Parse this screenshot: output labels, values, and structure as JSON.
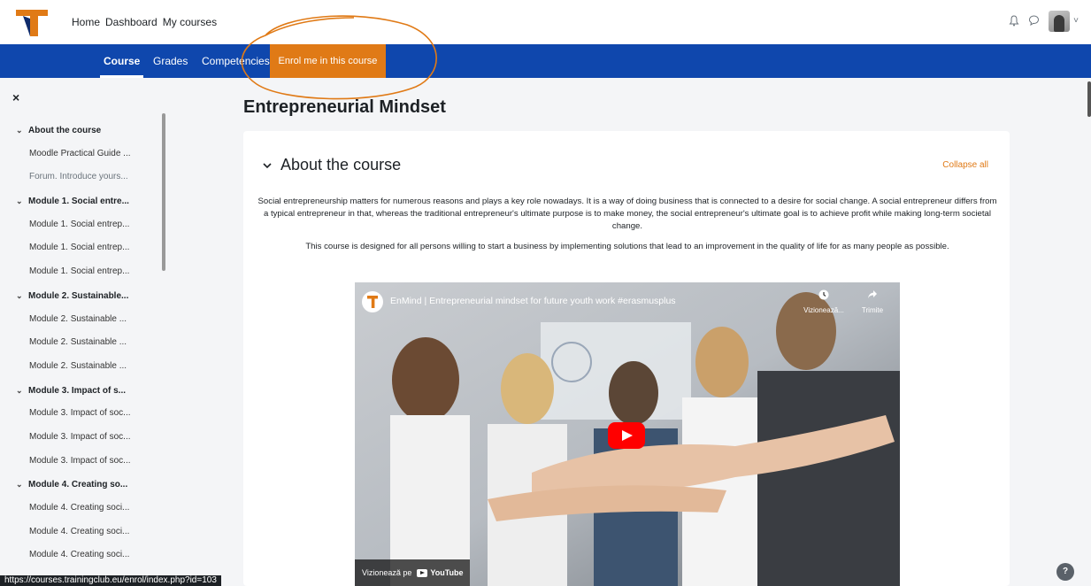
{
  "topnav": {
    "items": [
      "Home",
      "Dashboard",
      "My courses"
    ]
  },
  "top_right": {
    "bell_icon": "bell-icon",
    "messages_icon": "chat-icon",
    "user_menu_caret": "˅"
  },
  "subnav": {
    "tabs": [
      "Course",
      "Grades",
      "Competencies"
    ],
    "active_tab": "Course",
    "enrol_label": "Enrol me in this course",
    "color": "#0f47ad",
    "accent": "#e07a16"
  },
  "drawer": {
    "close": "×",
    "items": [
      {
        "label": "About the course",
        "type": "section"
      },
      {
        "label": "Moodle Practical Guide ...",
        "type": "child"
      },
      {
        "label": "Forum. Introduce yours...",
        "type": "child",
        "dim": true
      },
      {
        "label": "Module 1. Social entre...",
        "type": "section"
      },
      {
        "label": "Module 1. Social entrep...",
        "type": "child"
      },
      {
        "label": "Module 1. Social entrep...",
        "type": "child"
      },
      {
        "label": "Module 1. Social entrep...",
        "type": "child"
      },
      {
        "label": "Module 2. Sustainable...",
        "type": "section"
      },
      {
        "label": "Module 2. Sustainable ...",
        "type": "child"
      },
      {
        "label": "Module 2. Sustainable ...",
        "type": "child"
      },
      {
        "label": "Module 2. Sustainable ...",
        "type": "child"
      },
      {
        "label": "Module 3. Impact of s...",
        "type": "section"
      },
      {
        "label": "Module 3. Impact of soc...",
        "type": "child"
      },
      {
        "label": "Module 3. Impact of soc...",
        "type": "child"
      },
      {
        "label": "Module 3. Impact of soc...",
        "type": "child"
      },
      {
        "label": "Module 4. Creating so...",
        "type": "section"
      },
      {
        "label": "Module 4. Creating soci...",
        "type": "child"
      },
      {
        "label": "Module 4. Creating soci...",
        "type": "child"
      },
      {
        "label": "Module 4. Creating soci...",
        "type": "child"
      }
    ]
  },
  "main": {
    "title": "Entrepreneurial Mindset",
    "section_title": "About the course",
    "collapse_all": "Collapse all",
    "summary_p1": "Social entrepreneurship matters for numerous reasons and plays a key role nowadays. It is a way of doing business that is connected to a desire for social change. A social entrepreneur differs from a typical entrepreneur in that, whereas the traditional entrepreneur's ultimate purpose is to make money, the social entrepreneur's ultimate goal is to achieve profit while making long-term societal change.",
    "summary_p2": "This course is designed for all persons willing to start a business by implementing solutions that lead to an improvement in the quality of life for as many people as possible."
  },
  "video": {
    "title": "EnMind | Entrepreneurial mindset for future youth work #erasmusplus",
    "watch_later": "Vizionează...",
    "share": "Trimite",
    "watch_on": "Vizionează pe",
    "youtube": "YouTube"
  },
  "status_url": "https://courses.trainingclub.eu/enrol/index.php?id=103",
  "help": "?"
}
